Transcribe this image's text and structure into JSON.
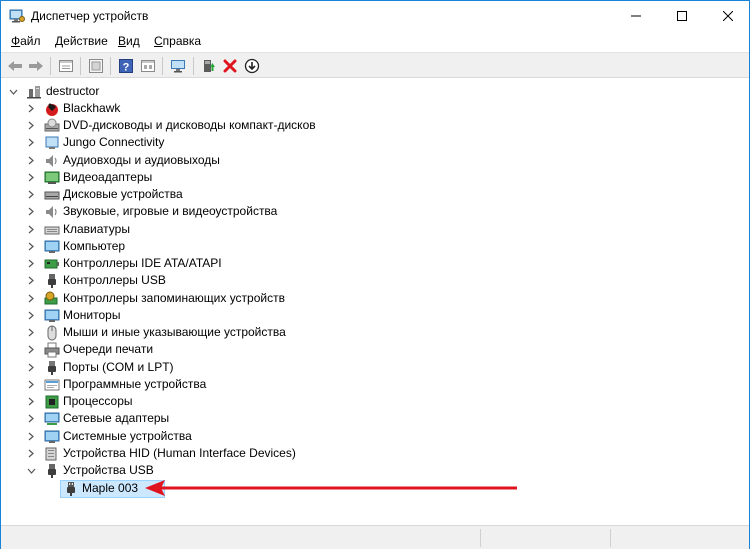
{
  "window": {
    "title": "Диспетчер устройств",
    "app_icon": "device-manager-icon",
    "controls": {
      "minimize": "—",
      "maximize": "☐",
      "close": "✕"
    }
  },
  "menu": [
    {
      "label": "Файл",
      "ul": "Ф",
      "rest": "айл"
    },
    {
      "label": "Действие",
      "ul": "Д",
      "rest": "ействие"
    },
    {
      "label": "Вид",
      "ul": "В",
      "rest": "ид"
    },
    {
      "label": "Справка",
      "ul": "С",
      "rest": "правка"
    }
  ],
  "toolbar": {
    "buttons": [
      "back-arrow-icon",
      "forward-arrow-icon",
      "properties-icon",
      "show-hidden-icon",
      "help-icon",
      "view-icon",
      "scan-hardware-icon",
      "update-driver-icon",
      "uninstall-icon",
      "download-icon"
    ]
  },
  "tree": {
    "root": "destructor",
    "categories": [
      {
        "label": "Blackhawk",
        "icon": "blackhawk-icon"
      },
      {
        "label": "DVD-дисководы и дисководы компакт-дисков",
        "icon": "dvd-drive-icon"
      },
      {
        "label": "Jungo Connectivity",
        "icon": "jungo-icon"
      },
      {
        "label": "Аудиовходы и аудиовыходы",
        "icon": "speaker-icon"
      },
      {
        "label": "Видеоадаптеры",
        "icon": "display-adapter-icon"
      },
      {
        "label": "Дисковые устройства",
        "icon": "disk-drive-icon"
      },
      {
        "label": "Звуковые, игровые и видеоустройства",
        "icon": "sound-icon"
      },
      {
        "label": "Клавиатуры",
        "icon": "keyboard-icon"
      },
      {
        "label": "Компьютер",
        "icon": "computer-icon"
      },
      {
        "label": "Контроллеры IDE ATA/ATAPI",
        "icon": "ide-controller-icon"
      },
      {
        "label": "Контроллеры USB",
        "icon": "usb-controller-icon"
      },
      {
        "label": "Контроллеры запоминающих устройств",
        "icon": "storage-controller-icon"
      },
      {
        "label": "Мониторы",
        "icon": "monitor-icon"
      },
      {
        "label": "Мыши и иные указывающие устройства",
        "icon": "mouse-icon"
      },
      {
        "label": "Очереди печати",
        "icon": "printer-icon"
      },
      {
        "label": "Порты (COM и LPT)",
        "icon": "port-icon"
      },
      {
        "label": "Программные устройства",
        "icon": "software-device-icon"
      },
      {
        "label": "Процессоры",
        "icon": "processor-icon"
      },
      {
        "label": "Сетевые адаптеры",
        "icon": "network-adapter-icon"
      },
      {
        "label": "Системные устройства",
        "icon": "system-device-icon"
      },
      {
        "label": "Устройства HID (Human Interface Devices)",
        "icon": "hid-icon"
      },
      {
        "label": "Устройства USB",
        "icon": "usb-device-icon",
        "expanded": true
      }
    ],
    "selected_child": {
      "label": "Maple 003",
      "icon": "usb-plug-icon"
    }
  },
  "annotation": {
    "arrow_color": "#e0141e"
  },
  "colors": {
    "selection": "#cce8ff",
    "window_border": "#1883d7"
  }
}
